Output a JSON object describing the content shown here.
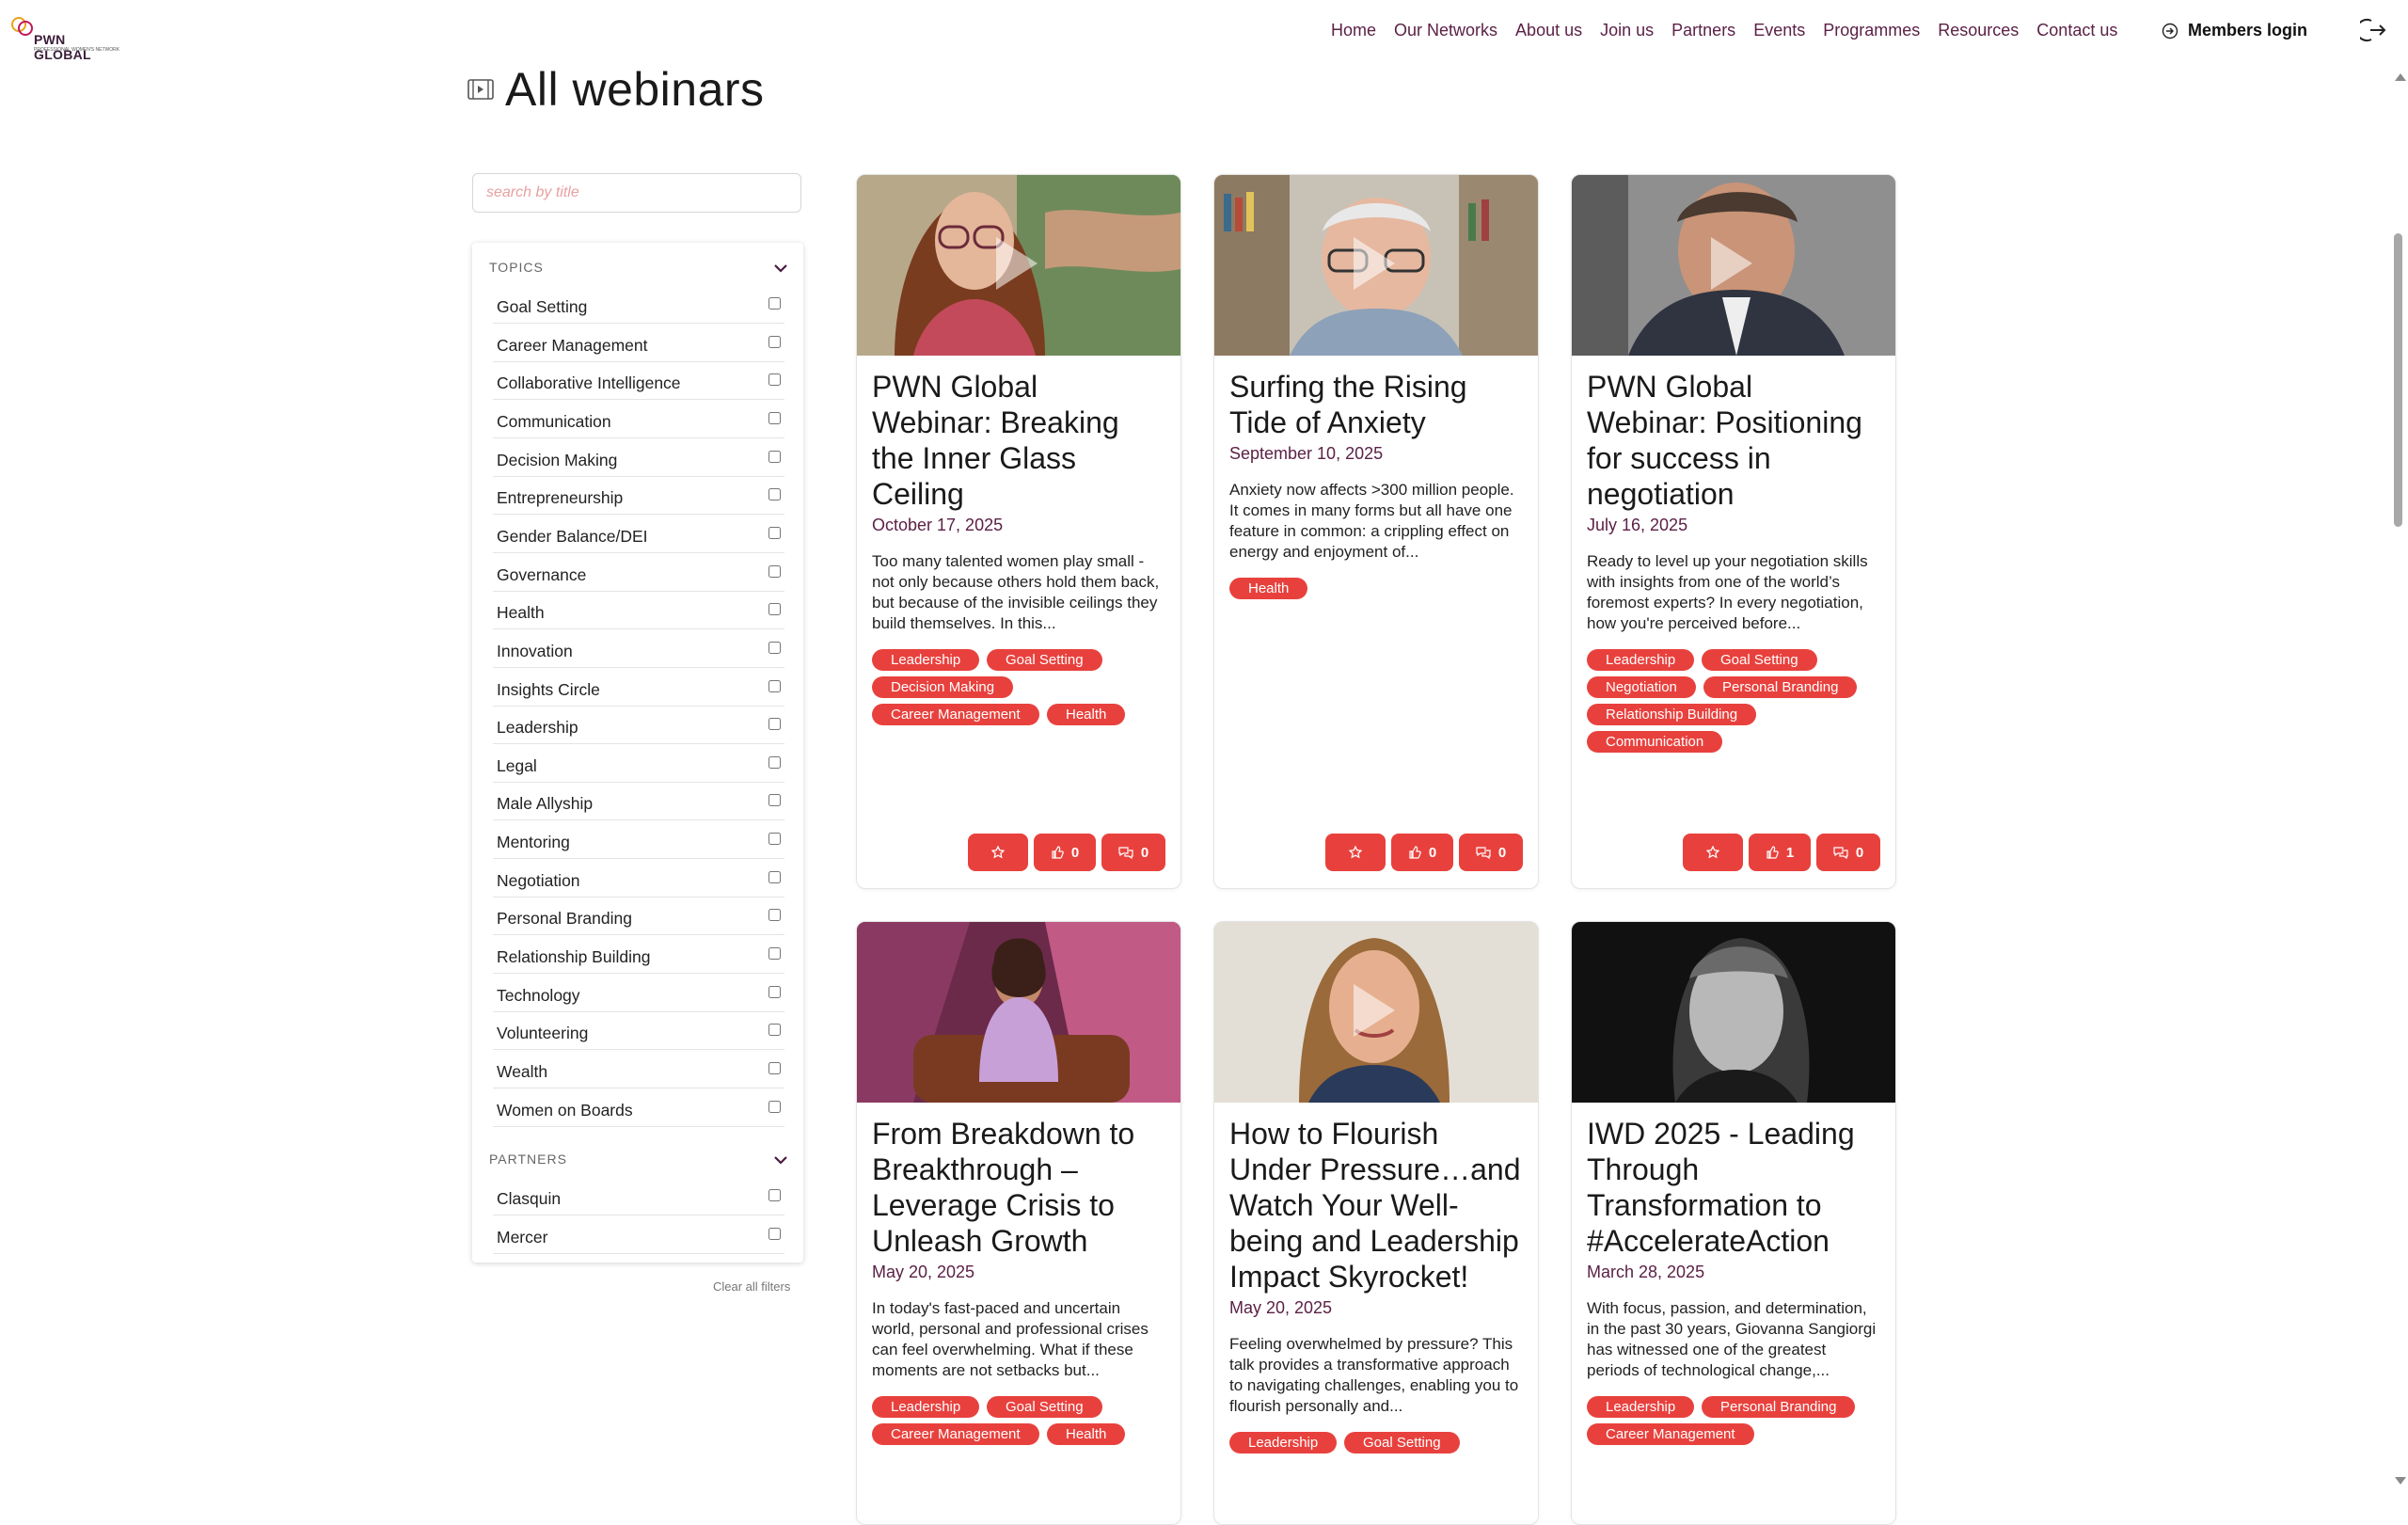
{
  "header": {
    "logo_text": "PWN GLOBAL",
    "logo_tagline": "PROFESSIONAL WOMEN'S NETWORK",
    "nav": [
      "Home",
      "Our Networks",
      "About us",
      "Join us",
      "Partners",
      "Events",
      "Programmes",
      "Resources",
      "Contact us"
    ],
    "members_login": "Members login"
  },
  "page": {
    "title": "All webinars"
  },
  "search": {
    "placeholder": "search by title"
  },
  "filters": {
    "topics_heading": "TOPICS",
    "topics": [
      "Goal Setting",
      "Career Management",
      "Collaborative Intelligence",
      "Communication",
      "Decision Making",
      "Entrepreneurship",
      "Gender Balance/DEI",
      "Governance",
      "Health",
      "Innovation",
      "Insights Circle",
      "Leadership",
      "Legal",
      "Male Allyship",
      "Mentoring",
      "Negotiation",
      "Personal Branding",
      "Relationship Building",
      "Technology",
      "Volunteering",
      "Wealth",
      "Women on Boards"
    ],
    "partners_heading": "PARTNERS",
    "partners": [
      "Clasquin",
      "Mercer"
    ],
    "clear_label": "Clear all filters"
  },
  "colors": {
    "accent": "#e8413d",
    "brand": "#5b2146"
  },
  "cards": [
    {
      "title": "PWN Global Webinar: Breaking the Inner Glass Ceiling",
      "date": "October 17, 2025",
      "description": "Too many talented women play small - not only because others hold them back, but because of the invisible ceilings they build themselves. In this...",
      "tags": [
        "Leadership",
        "Goal Setting",
        "Decision Making",
        "Career Management",
        "Health"
      ],
      "likes": "0",
      "comments": "0",
      "has_play": true
    },
    {
      "title": "Surfing the Rising Tide of Anxiety",
      "date": "September 10, 2025",
      "description": "Anxiety now affects >300 million people. It comes in many forms but all have one feature in common: a crippling effect on energy and enjoyment of...",
      "tags": [
        "Health"
      ],
      "likes": "0",
      "comments": "0",
      "has_play": true
    },
    {
      "title": "PWN Global Webinar: Positioning for success in negotiation",
      "date": "July 16, 2025",
      "description": "Ready to level up your negotiation skills with insights from one of the world’s foremost experts? In every negotiation, how you're perceived before...",
      "tags": [
        "Leadership",
        "Goal Setting",
        "Negotiation",
        "Personal Branding",
        "Relationship Building",
        "Communication"
      ],
      "likes": "1",
      "comments": "0",
      "has_play": true
    },
    {
      "title": "From Breakdown to Breakthrough – Leverage Crisis to Unleash Growth",
      "date": "May 20, 2025",
      "description": "In today's fast-paced and uncertain world, personal and professional crises can feel overwhelming. What if these moments are not setbacks but...",
      "tags": [
        "Leadership",
        "Goal Setting",
        "Career Management",
        "Health"
      ],
      "has_play": false
    },
    {
      "title": "How to Flourish Under Pressure…and Watch Your Well-being and Leadership Impact Skyrocket!",
      "date": "May 20, 2025",
      "description": "Feeling overwhelmed by pressure? This talk provides a transformative approach to navigating challenges, enabling you to flourish personally and...",
      "tags": [
        "Leadership",
        "Goal Setting"
      ],
      "has_play": true
    },
    {
      "title": "IWD 2025 - Leading Through Transformation to #AccelerateAction",
      "date": "March 28, 2025",
      "description": "With focus, passion, and determination, in the past 30 years, Giovanna Sangiorgi has witnessed one of the greatest periods of technological change,...",
      "tags": [
        "Leadership",
        "Personal Branding",
        "Career Management"
      ],
      "has_play": false
    }
  ]
}
